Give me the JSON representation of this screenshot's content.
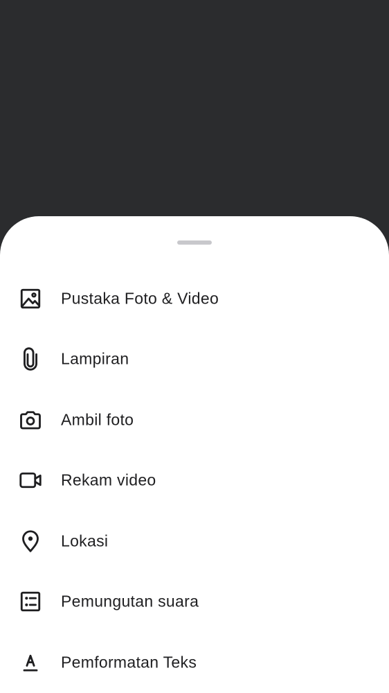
{
  "colors": {
    "backdrop": "#2b2c2e",
    "sheet": "#ffffff",
    "handle": "#c8c8cc",
    "text": "#1f1f21",
    "icon": "#1f1f21"
  },
  "sheet": {
    "items": [
      {
        "label": "Pustaka Foto & Video",
        "icon": "image-icon"
      },
      {
        "label": "Lampiran",
        "icon": "paperclip-icon"
      },
      {
        "label": "Ambil foto",
        "icon": "camera-icon"
      },
      {
        "label": "Rekam video",
        "icon": "video-camera-icon"
      },
      {
        "label": "Lokasi",
        "icon": "location-pin-icon"
      },
      {
        "label": "Pemungutan suara",
        "icon": "poll-icon"
      },
      {
        "label": "Pemformatan Teks",
        "icon": "text-format-icon"
      }
    ]
  }
}
